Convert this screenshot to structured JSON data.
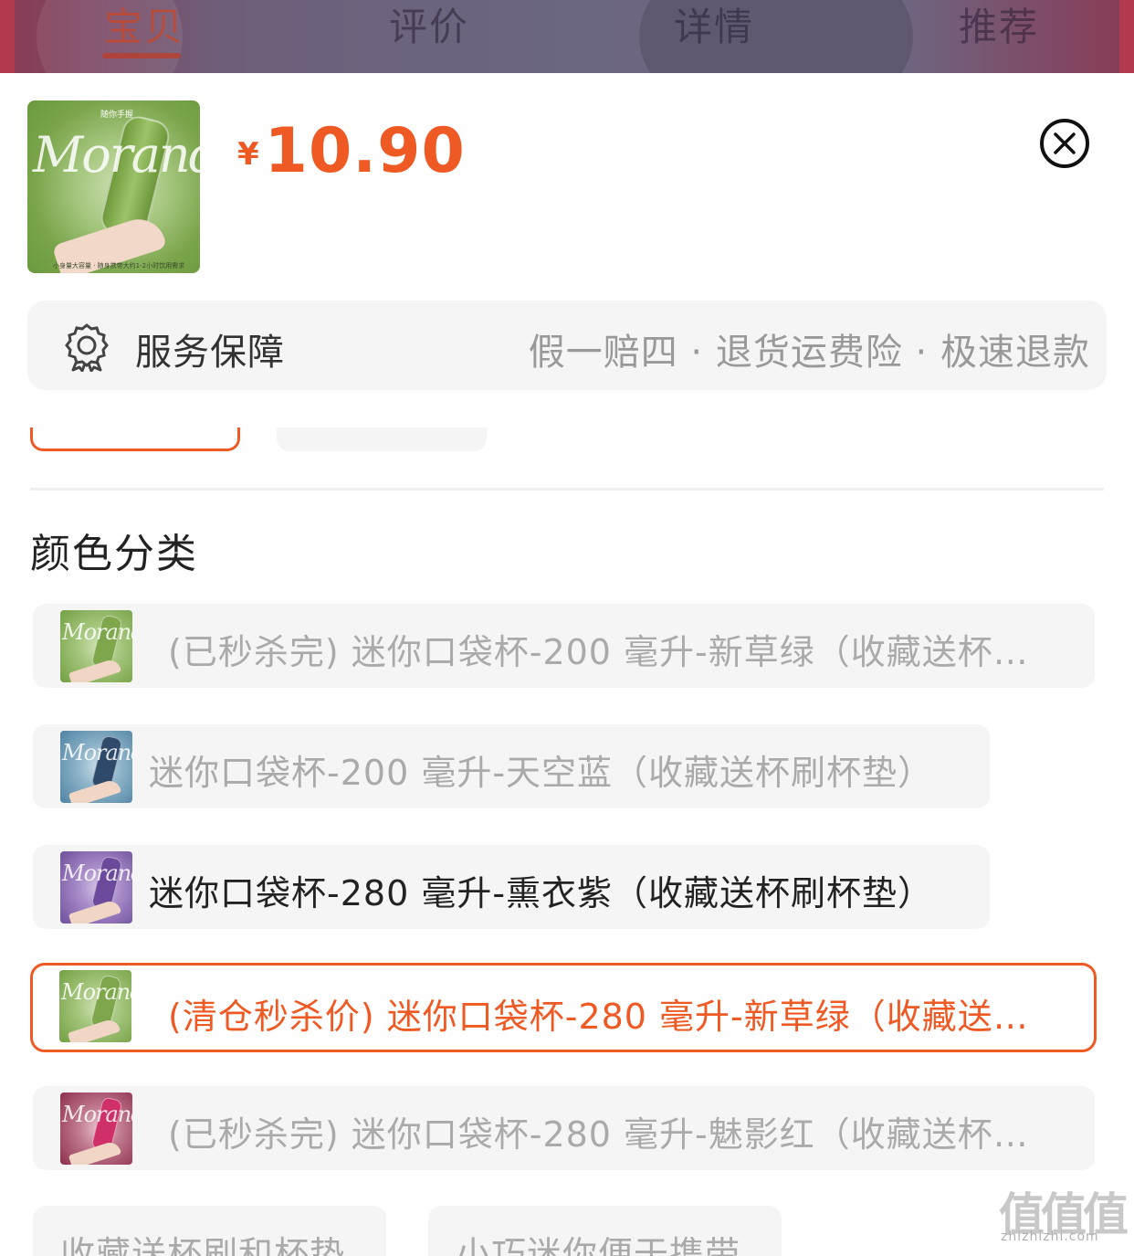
{
  "top_tabs": [
    {
      "label": "宝贝",
      "active": true
    },
    {
      "label": "评价",
      "active": false
    },
    {
      "label": "详情",
      "active": false
    },
    {
      "label": "推荐",
      "active": false
    }
  ],
  "product": {
    "thumb_script": "Morandi",
    "thumb_top_text": "随你手握",
    "thumb_bottom_text": "小身量大容量 · 随身携带大约1-2小时饮用需求",
    "currency": "¥",
    "price": "10.90"
  },
  "service": {
    "icon": "badge-icon",
    "label": "服务保障",
    "description": "假一赔四 · 退货运费险 · 极速退款"
  },
  "section": {
    "title": "颜色分类"
  },
  "options": [
    {
      "text": "(已秒杀完) 迷你口袋杯-200 毫升-新草绿（收藏送杯…",
      "state": "disabled",
      "thumb_color": "green"
    },
    {
      "text": "迷你口袋杯-200 毫升-天空蓝（收藏送杯刷杯垫）",
      "state": "disabled",
      "thumb_color": "blue"
    },
    {
      "text": "迷你口袋杯-280 毫升-熏衣紫（收藏送杯刷杯垫）",
      "state": "available",
      "thumb_color": "purple"
    },
    {
      "text": "(清仓秒杀价) 迷你口袋杯-280 毫升-新草绿（收藏送…",
      "state": "selected",
      "thumb_color": "green"
    },
    {
      "text": "(已秒杀完) 迷你口袋杯-280 毫升-魅影红（收藏送杯…",
      "state": "disabled",
      "thumb_color": "red"
    }
  ],
  "bottom_chips": [
    {
      "text": "收藏送杯刷和杯垫"
    },
    {
      "text": "小巧迷你便于携带"
    }
  ],
  "watermark": {
    "big": "值值值",
    "small": "zhizhizhi.com"
  },
  "colors": {
    "accent": "#ef5a24",
    "chip_bg": "#f5f5f5",
    "disabled_text": "#aaaaaa"
  }
}
